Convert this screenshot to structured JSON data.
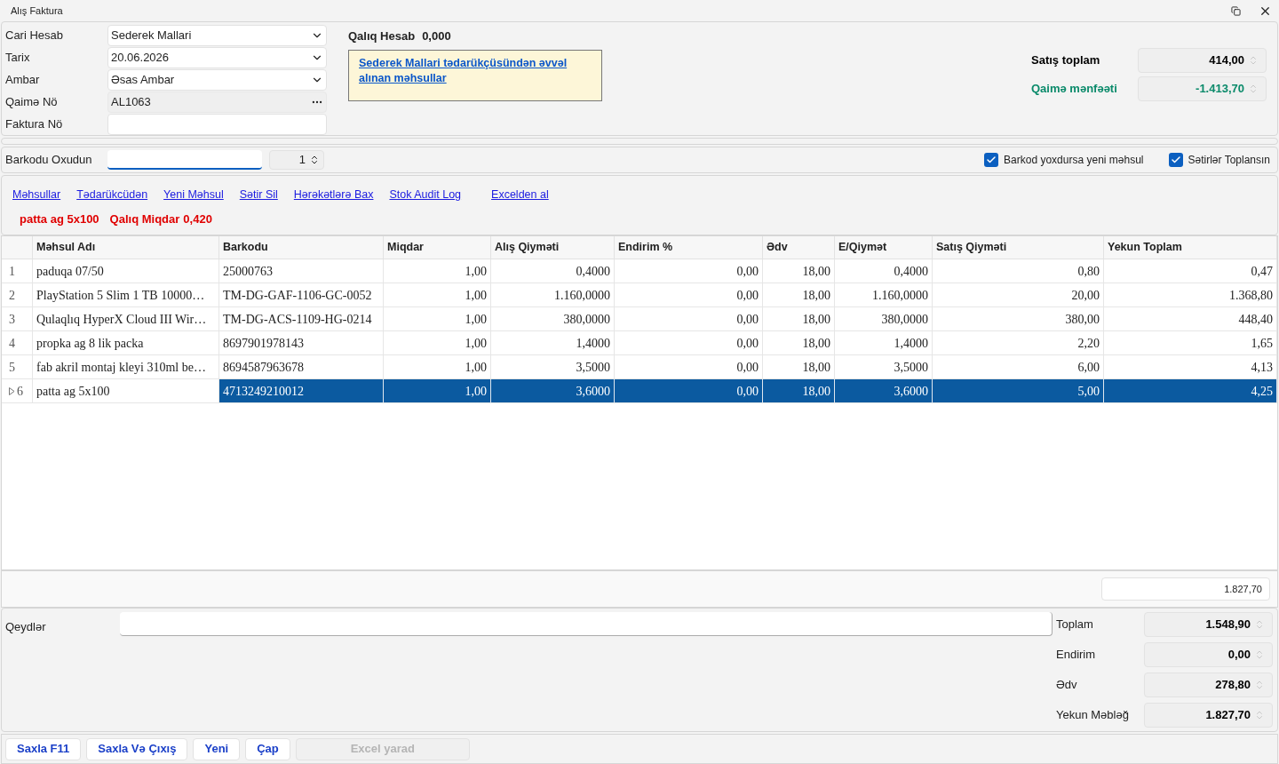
{
  "window": {
    "title": "Alış Faktura"
  },
  "header": {
    "fields": [
      {
        "label": "Cari Hesab",
        "value": "Sederek Mallari",
        "kind": "dropdown"
      },
      {
        "label": "Tarix",
        "value": "20.06.2026",
        "kind": "dropdown"
      },
      {
        "label": "Ambar",
        "value": "Əsas Ambar",
        "kind": "dropdown"
      },
      {
        "label": "Qaimə Nö",
        "value": "AL1063",
        "kind": "ellipsis"
      },
      {
        "label": "Faktura Nö",
        "kind": "text"
      }
    ],
    "balance": {
      "label": "Qalıq Hesab",
      "value": "0,000"
    },
    "note_link": "Sederek Mallari tədarükçüsündən əvvəl alınan məhsullar",
    "summary": [
      {
        "label": "Satış toplam",
        "value": "414,00",
        "kind": "normal"
      },
      {
        "label": "Qaimə mənfəəti",
        "value": "-1.413,70",
        "kind": "profit"
      }
    ]
  },
  "barcode": {
    "label": "Barkodu Oxudun",
    "quantity": "1"
  },
  "checkboxes": [
    {
      "label": "Barkod yoxdursa yeni məhsul",
      "checked": true
    },
    {
      "label": "Sətirlər Toplansın",
      "checked": true
    }
  ],
  "links": [
    "Məhsullar",
    "Tədarükcüdən",
    "Yeni Məhsul",
    "Sətir Sil",
    "Hərəkətlərə Bax",
    "Stok Audit Log",
    "Excelden al"
  ],
  "status": {
    "product": "patta ag 5x100",
    "label": "Qalıq Miqdar",
    "value": "0,420"
  },
  "table": {
    "columns": [
      "Məhsul Adı",
      "Barkodu",
      "Miqdar",
      "Alış Qiyməti",
      "Endirim %",
      "Ədv",
      "E/Qiymət",
      "Satış Qiyməti",
      "Yekun Toplam"
    ],
    "rows": [
      {
        "number": "1",
        "selected": false,
        "cells": [
          "paduqa 07/50",
          "25000763",
          "1,00",
          "0,4000",
          "0,00",
          "18,00",
          "0,4000",
          "0,80",
          "0,47"
        ]
      },
      {
        "number": "2",
        "selected": false,
        "cells": [
          "PlayStation 5 Slim 1 TB 10000…",
          "TM-DG-GAF-1106-GC-0052",
          "1,00",
          "1.160,0000",
          "0,00",
          "18,00",
          "1.160,0000",
          "20,00",
          "1.368,80"
        ]
      },
      {
        "number": "3",
        "selected": false,
        "cells": [
          "Qulaqlıq HyperX Cloud III Wir…",
          "TM-DG-ACS-1109-HG-0214",
          "1,00",
          "380,0000",
          "0,00",
          "18,00",
          "380,0000",
          "380,00",
          "448,40"
        ]
      },
      {
        "number": "4",
        "selected": false,
        "cells": [
          "propka ag 8 lik packa",
          "8697901978143",
          "1,00",
          "1,4000",
          "0,00",
          "18,00",
          "1,4000",
          "2,20",
          "1,65"
        ]
      },
      {
        "number": "5",
        "selected": false,
        "cells": [
          "fab  akril montaj kleyi 310ml be…",
          "8694587963678",
          "1,00",
          "3,5000",
          "0,00",
          "18,00",
          "3,5000",
          "6,00",
          "4,13"
        ]
      },
      {
        "number": "6",
        "selected": true,
        "cells": [
          "patta ag 5x100",
          "4713249210012",
          "1,00",
          "3,6000",
          "0,00",
          "18,00",
          "3,6000",
          "5,00",
          "4,25"
        ]
      }
    ],
    "footer_total": "1.827,70"
  },
  "notes": {
    "label": "Qeydlər"
  },
  "totals": [
    {
      "label": "Toplam",
      "value": "1.548,90"
    },
    {
      "label": "Endirim",
      "value": "0,00"
    },
    {
      "label": "Ədv",
      "value": "278,80"
    },
    {
      "label": "Yekun Məbləğ",
      "value": "1.827,70"
    }
  ],
  "buttons": [
    {
      "label": "Saxla F11",
      "disabled": false
    },
    {
      "label": "Saxla Və Çıxış",
      "disabled": false
    },
    {
      "label": "Yeni",
      "disabled": false
    },
    {
      "label": "Çap",
      "disabled": false
    },
    {
      "label": "Excel yarad",
      "disabled": true
    }
  ]
}
